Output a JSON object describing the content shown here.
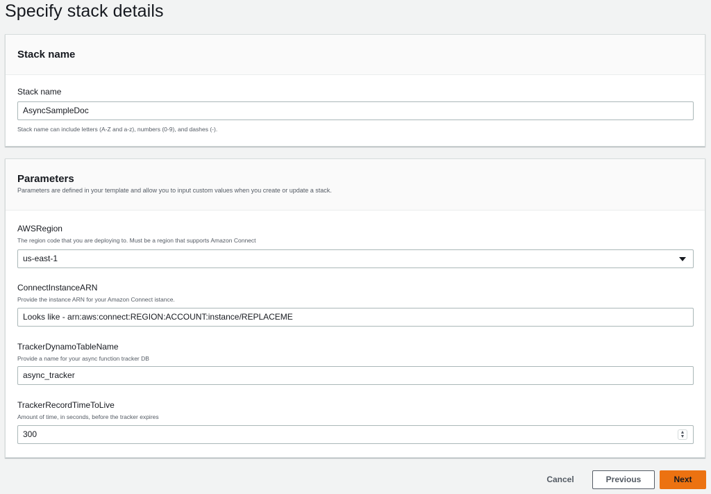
{
  "page": {
    "title": "Specify stack details"
  },
  "stack_name_panel": {
    "title": "Stack name",
    "field": {
      "label": "Stack name",
      "value": "AsyncSampleDoc",
      "constraint": "Stack name can include letters (A-Z and a-z), numbers (0-9), and dashes (-)."
    }
  },
  "parameters_panel": {
    "title": "Parameters",
    "description": "Parameters are defined in your template and allow you to input custom values when you create or update a stack.",
    "fields": [
      {
        "label": "AWSRegion",
        "description": "The region code that you are deploying to. Must be a region that supports Amazon Connect",
        "value": "us-east-1",
        "type": "select"
      },
      {
        "label": "ConnectInstanceARN",
        "description": "Provide the instance ARN for your Amazon Connect istance.",
        "value": "Looks like - arn:aws:connect:REGION:ACCOUNT:instance/REPLACEME",
        "type": "text"
      },
      {
        "label": "TrackerDynamoTableName",
        "description": "Provide a name for your async function tracker DB",
        "value": "async_tracker",
        "type": "text"
      },
      {
        "label": "TrackerRecordTimeToLive",
        "description": "Amount of time, in seconds, before the tracker expires",
        "value": "300",
        "type": "number"
      }
    ]
  },
  "footer": {
    "cancel_label": "Cancel",
    "previous_label": "Previous",
    "next_label": "Next"
  },
  "icons": {
    "select_caret": "caret-down-icon",
    "number_spinner": "spinner-icon"
  },
  "colors": {
    "primary_button": "#ec7211",
    "background": "#f2f3f3",
    "panel_header": "#fafafa",
    "input_border": "#aab7b8"
  }
}
